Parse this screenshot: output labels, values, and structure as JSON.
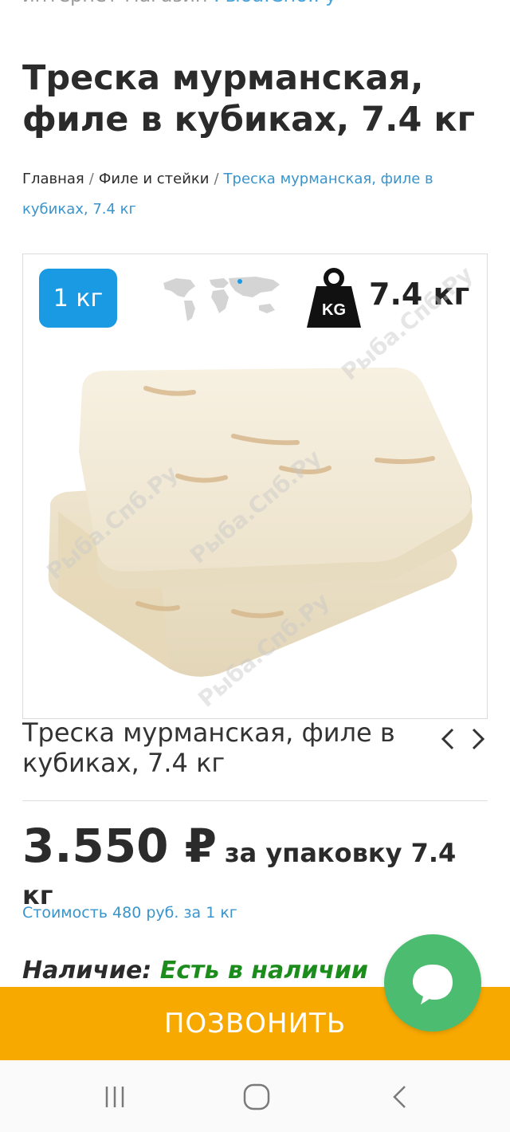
{
  "header": {
    "tagline": "интернет-магазин",
    "brand": "Рыба.Спб.Ру"
  },
  "product": {
    "title": "Треска мурманская, филе в кубиках, 7.4 кг",
    "caption": "Треска мурманская, филе в кубиках, 7.4 кг",
    "badge_weight": "1 кг",
    "total_weight": "7.4 кг",
    "kg_icon_label": "KG",
    "watermark": "Рыба.Спб.Ру"
  },
  "breadcrumb": {
    "items": [
      "Главная",
      "Филе и стейки"
    ],
    "separator": "/",
    "current": "Треска мурманская, филе в кубиках, 7.4 кг"
  },
  "pricing": {
    "price": "3.550 ₽",
    "per_pack_line1": "за упаковку 7.4",
    "per_pack_line2": "кг",
    "unit_cost": "Стоимость 480 руб. за 1 кг"
  },
  "availability": {
    "label": "Наличие:",
    "status": "Есть в наличии"
  },
  "actions": {
    "call_label": "ПОЗВОНИТЬ"
  },
  "colors": {
    "accent_blue": "#1a9ae3",
    "link_blue": "#3a94cc",
    "call_bar": "#f7a900",
    "chat_green": "#4cbd70",
    "stock_green": "#1c8d1c"
  },
  "icons": {
    "map": "world-map-icon",
    "weight": "kg-weight-icon",
    "prev": "chevron-left-icon",
    "next": "chevron-right-icon",
    "chat": "chat-bubble-icon",
    "recent": "recent-apps-icon",
    "home": "home-icon",
    "back": "back-icon"
  }
}
